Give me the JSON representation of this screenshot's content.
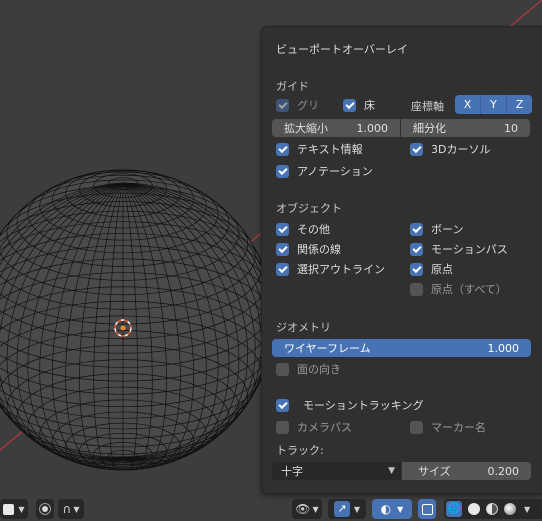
{
  "overlay": {
    "title": "ビューポートオーバーレイ",
    "guides": {
      "heading": "ガイド",
      "grid_label": "グリ",
      "floor_label": "床",
      "axes_label": "座標軸",
      "axes": [
        "X",
        "Y",
        "Z"
      ],
      "scale_label": "拡大縮小",
      "scale_value": "1.000",
      "subdivisions_label": "細分化",
      "subdivisions_value": "10",
      "text_info_label": "テキスト情報",
      "cursor_3d_label": "3Dカーソル",
      "annotations_label": "アノテーション"
    },
    "objects": {
      "heading": "オブジェクト",
      "extras_label": "その他",
      "bones_label": "ボーン",
      "relationship_lines_label": "関係の線",
      "motion_paths_label": "モーションパス",
      "outline_selected_label": "選択アウトライン",
      "origins_label": "原点",
      "origins_all_label": "原点（すべて）"
    },
    "geometry": {
      "heading": "ジオメトリ",
      "wireframe_label": "ワイヤーフレーム",
      "wireframe_value": "1.000",
      "face_orientation_label": "面の向き"
    },
    "motion_tracking": {
      "label": "モーショントラッキング",
      "camera_path_label": "カメラパス",
      "marker_names_label": "マーカー名",
      "tracks_label": "トラック:",
      "track_display_value": "十字",
      "size_label": "サイズ",
      "size_value": "0.200"
    }
  },
  "colors": {
    "accent": "#4772b3",
    "panel_bg": "#303030",
    "viewport_bg": "#3d3d3d",
    "x_axis": "#c13d4a"
  }
}
